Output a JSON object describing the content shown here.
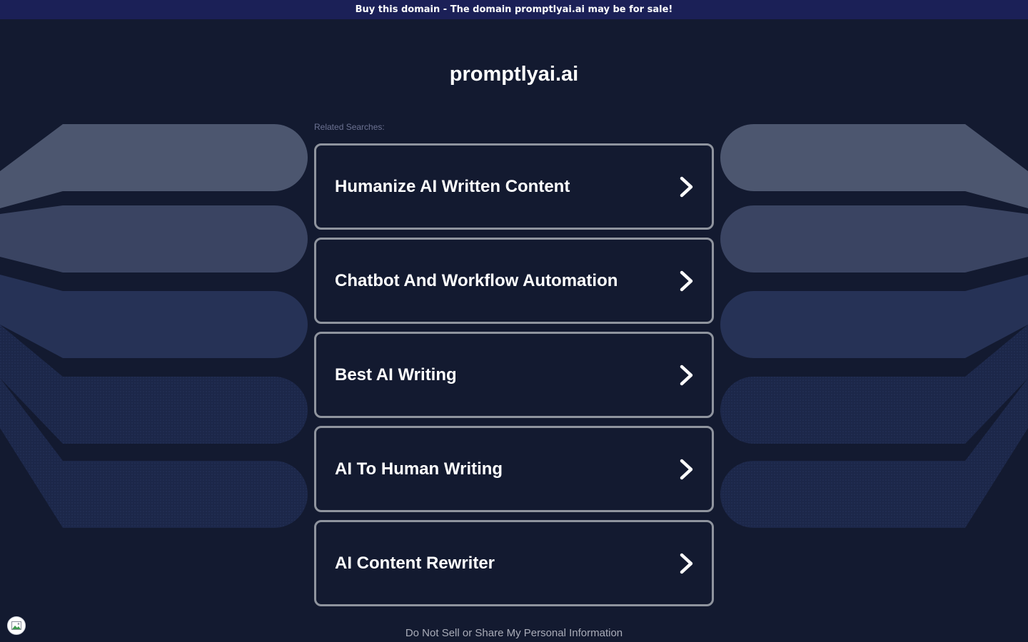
{
  "banner": {
    "text": "Buy this domain - The domain promptlyai.ai may be for sale!"
  },
  "site": {
    "title": "promptlyai.ai"
  },
  "related": {
    "label": "Related Searches:",
    "items": [
      {
        "label": "Humanize AI Written Content"
      },
      {
        "label": "Chatbot And Workflow Automation"
      },
      {
        "label": "Best AI Writing"
      },
      {
        "label": "AI To Human Writing"
      },
      {
        "label": "AI Content Rewriter"
      }
    ]
  },
  "footer": {
    "privacy_link": "Do Not Sell or Share My Personal Information"
  },
  "icons": {
    "chevron": "chevron-right-icon",
    "privacy_badge": "privacy-options-icon"
  },
  "colors": {
    "background": "#131a30",
    "banner": "#1b2057",
    "card_border": "#8f949e",
    "text": "#ffffff",
    "muted_text": "#6c7292"
  }
}
